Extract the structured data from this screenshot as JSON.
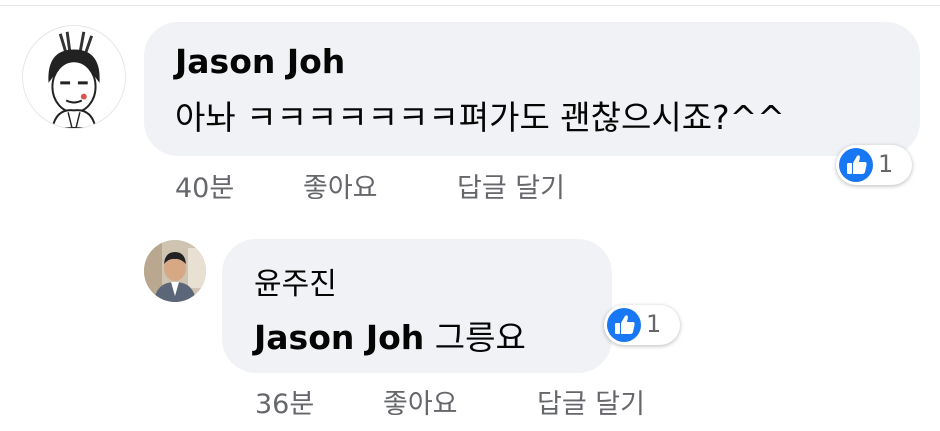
{
  "comments": [
    {
      "author": "Jason Joh",
      "text": "아놔 ㅋㅋㅋㅋㅋㅋㅋ펴가도 괜찮으시죠?^^",
      "time": "40분",
      "like_label": "좋아요",
      "reply_label": "답글 달기",
      "reaction_count": "1",
      "reaction_icon": "like-icon"
    },
    {
      "author": "윤주진",
      "text": "Jason Joh 그릉요",
      "time": "36분",
      "like_label": "좋아요",
      "reply_label": "답글 달기",
      "reaction_count": "1",
      "reaction_icon": "like-icon"
    }
  ],
  "colors": {
    "bubble": "#f0f2f5",
    "secondary_text": "#65676b",
    "like_blue": "#1877f2"
  }
}
